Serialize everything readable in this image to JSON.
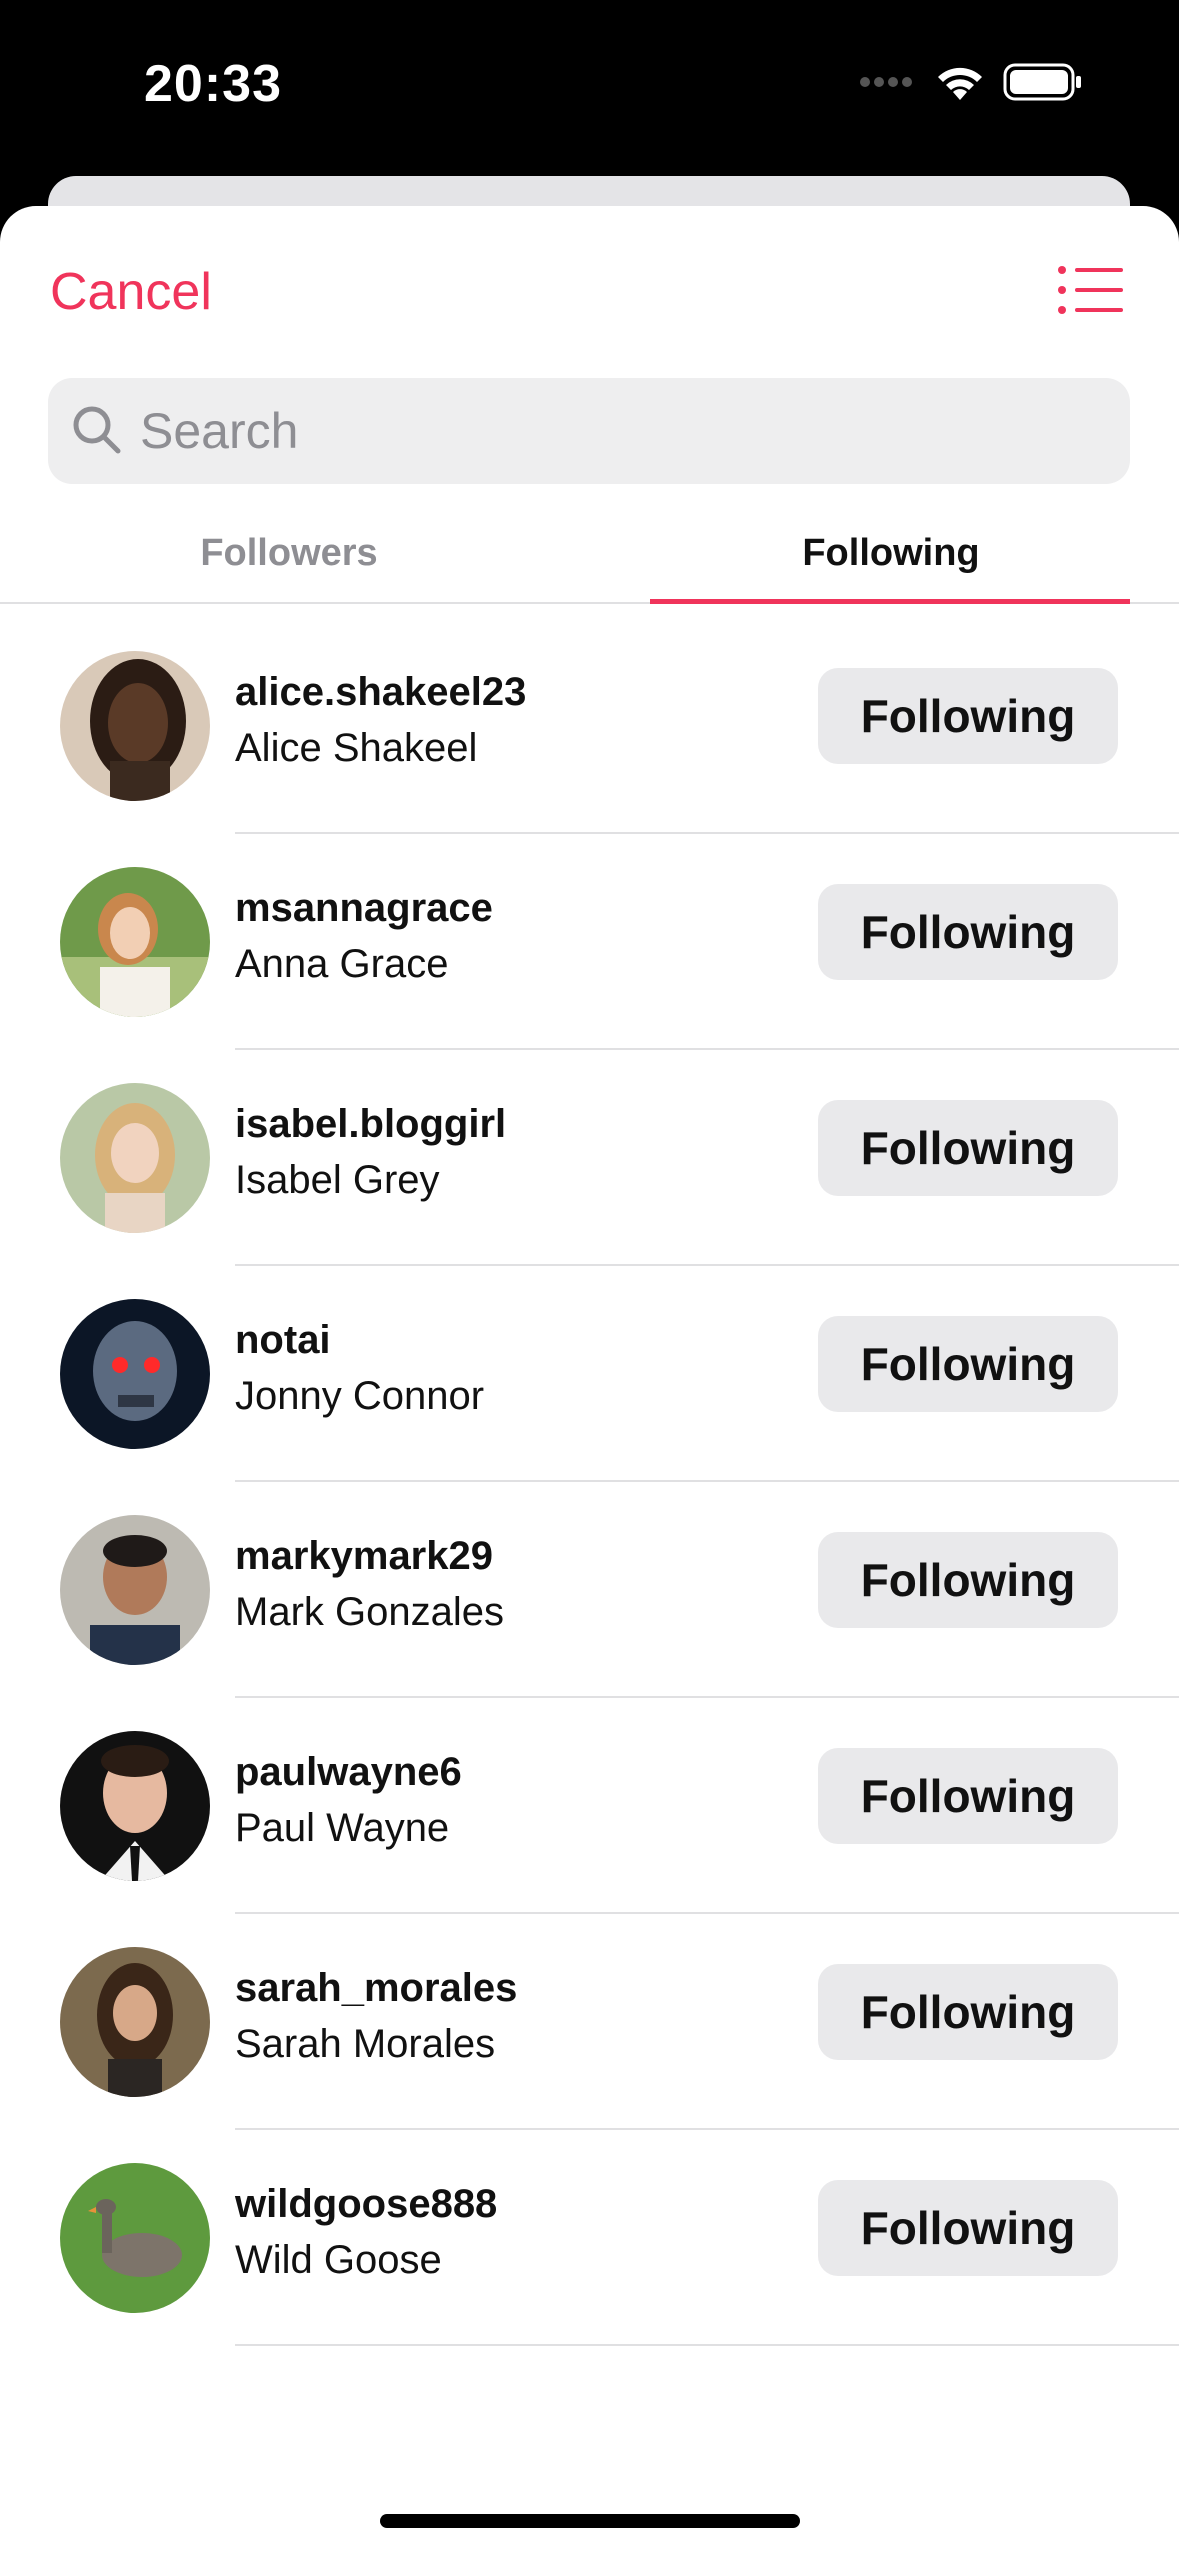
{
  "status_bar": {
    "time": "20:33"
  },
  "header": {
    "cancel_label": "Cancel",
    "list_icon": "list-icon"
  },
  "search": {
    "placeholder": "Search",
    "value": ""
  },
  "tabs": [
    {
      "label": "Followers",
      "selected": false
    },
    {
      "label": "Following",
      "selected": true
    }
  ],
  "colors": {
    "accent": "#f0345b",
    "button_bg": "#e9e9eb",
    "search_bg": "#eeeeef"
  },
  "users": [
    {
      "username": "alice.shakeel23",
      "name": "Alice Shakeel",
      "button": "Following"
    },
    {
      "username": "msannagrace",
      "name": "Anna Grace",
      "button": "Following"
    },
    {
      "username": "isabel.bloggirl",
      "name": "Isabel Grey",
      "button": "Following"
    },
    {
      "username": "notai",
      "name": "Jonny Connor",
      "button": "Following"
    },
    {
      "username": "markymark29",
      "name": "Mark Gonzales",
      "button": "Following"
    },
    {
      "username": "paulwayne6",
      "name": "Paul Wayne",
      "button": "Following"
    },
    {
      "username": "sarah_morales",
      "name": "Sarah Morales",
      "button": "Following"
    },
    {
      "username": "wildgoose888",
      "name": "Wild Goose",
      "button": "Following"
    }
  ]
}
